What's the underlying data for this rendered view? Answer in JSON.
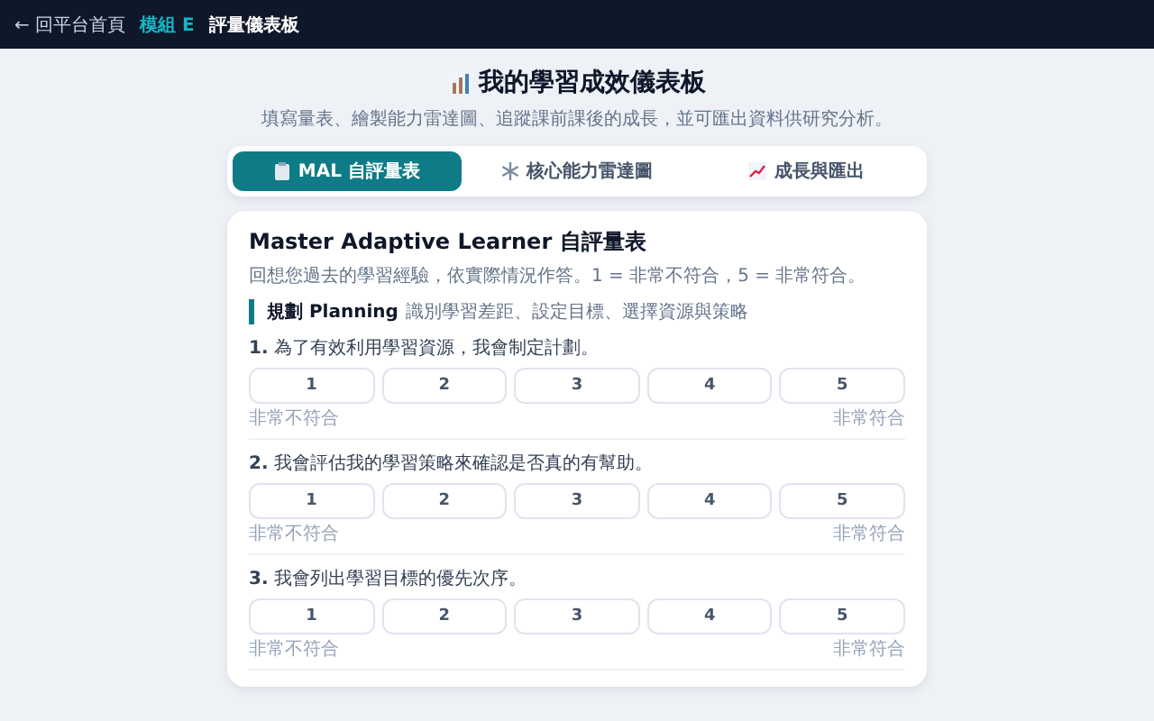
{
  "topbar": {
    "back_link": "← 回平台首頁",
    "module_badge": "模組 E",
    "title": "評量儀表板"
  },
  "header": {
    "title": "我的學習成效儀表板",
    "subtitle": "填寫量表、繪製能力雷達圖、追蹤課前課後的成長，並可匯出資料供研究分析。"
  },
  "tabs": [
    {
      "label": "MAL 自評量表",
      "selected": true
    },
    {
      "label": "核心能力雷達圖",
      "selected": false
    },
    {
      "label": "成長與匯出",
      "selected": false
    }
  ],
  "card": {
    "title": "Master Adaptive Learner 自評量表",
    "intro": "回想您過去的學習經驗，依實際情況作答。1 = 非常不符合，5 = 非常符合。",
    "section": {
      "name": "規劃 Planning",
      "description": "識別學習差距、設定目標、選擇資源與策略"
    },
    "questions": [
      {
        "number": "1.",
        "text": "為了有效利用學習資源，我會制定計劃。",
        "options": [
          {
            "label": "1",
            "selected": false
          },
          {
            "label": "2",
            "selected": false
          },
          {
            "label": "3",
            "selected": false
          },
          {
            "label": "4",
            "selected": false
          },
          {
            "label": "5",
            "selected": false
          }
        ],
        "low_label": "非常不符合",
        "high_label": "非常符合"
      },
      {
        "number": "2.",
        "text": "我會評估我的學習策略來確認是否真的有幫助。",
        "options": [
          {
            "label": "1",
            "selected": false
          },
          {
            "label": "2",
            "selected": false
          },
          {
            "label": "3",
            "selected": false
          },
          {
            "label": "4",
            "selected": false
          },
          {
            "label": "5",
            "selected": false
          }
        ],
        "low_label": "非常不符合",
        "high_label": "非常符合"
      },
      {
        "number": "3.",
        "text": "我會列出學習目標的優先次序。",
        "options": [
          {
            "label": "1",
            "selected": false
          },
          {
            "label": "2",
            "selected": false
          },
          {
            "label": "3",
            "selected": false
          },
          {
            "label": "4",
            "selected": false
          },
          {
            "label": "5",
            "selected": false
          }
        ],
        "low_label": "非常不符合",
        "high_label": "非常符合"
      }
    ]
  }
}
